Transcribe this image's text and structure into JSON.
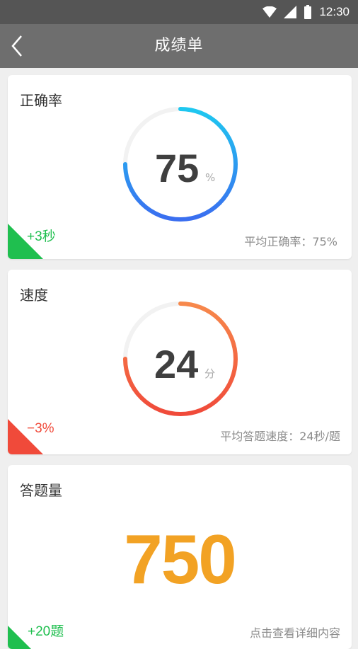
{
  "status_bar": {
    "time": "12:30"
  },
  "header": {
    "title": "成绩单"
  },
  "accuracy": {
    "title": "正确率",
    "value": "75",
    "unit": "%",
    "percent": 75,
    "delta": "+3秒",
    "average": "平均正确率：75%",
    "colors": {
      "ring_start": "#1ec8f0",
      "ring_end": "#3a6ef0",
      "track": "#f2f2f2",
      "corner": "#1fbf4f"
    }
  },
  "speed": {
    "title": "速度",
    "value": "24",
    "unit": "分",
    "percent": 75,
    "delta": "−3%",
    "average": "平均答题速度：24秒/题",
    "colors": {
      "ring_start": "#f7894c",
      "ring_end": "#f04a3a",
      "track": "#f2f2f2",
      "corner": "#f04a3a"
    }
  },
  "count": {
    "title": "答题量",
    "value": "750",
    "delta": "+20题",
    "detail_link": "点击查看详细内容",
    "colors": {
      "number": "#f2a224",
      "corner": "#1fbf4f"
    }
  }
}
